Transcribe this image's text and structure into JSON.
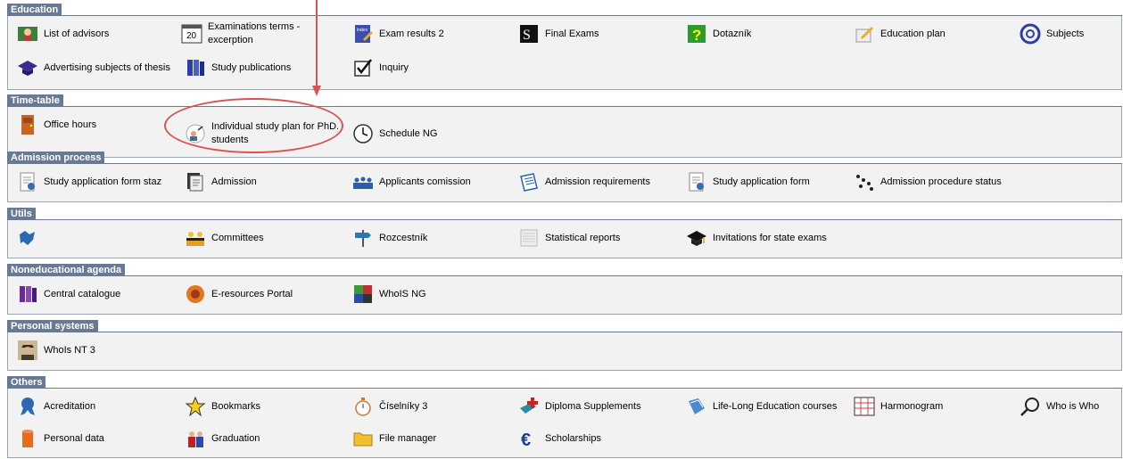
{
  "sections": [
    {
      "title": "Education",
      "items": [
        {
          "label": "List of advisors",
          "icon": "advisors-icon"
        },
        {
          "label": "Examinations terms - excerption",
          "icon": "calendar-icon"
        },
        {
          "label": "Exam results 2",
          "icon": "index-book-icon"
        },
        {
          "label": "Final Exams",
          "icon": "final-exams-icon"
        },
        {
          "label": "Dotazník",
          "icon": "questionnaire-icon"
        },
        {
          "label": "Education plan",
          "icon": "pencil-paper-icon"
        },
        {
          "label": "Subjects",
          "icon": "knot-icon"
        },
        {
          "label": "Advertising subjects of thesis",
          "icon": "graduation-cap-icon"
        },
        {
          "label": "Study publications",
          "icon": "books-icon"
        },
        {
          "label": "Inquiry",
          "icon": "checkbox-icon"
        }
      ]
    },
    {
      "title": "Time-table",
      "items": [
        {
          "label": "Office hours",
          "icon": "door-icon"
        },
        {
          "label": "Individual study plan for PhD. students",
          "icon": "study-plan-icon"
        },
        {
          "label": "Schedule NG",
          "icon": "clock-icon"
        }
      ]
    },
    {
      "title": "Admission process",
      "items": [
        {
          "label": "Study application form staz",
          "icon": "application-form-icon"
        },
        {
          "label": "Admission",
          "icon": "admission-doc-icon"
        },
        {
          "label": "Applicants comission",
          "icon": "people-icon"
        },
        {
          "label": "Admission requirements",
          "icon": "notepad-icon"
        },
        {
          "label": "Study application form",
          "icon": "application-form-icon"
        },
        {
          "label": "Admission procedure status",
          "icon": "dots-status-icon"
        }
      ]
    },
    {
      "title": "Utils",
      "items": [
        {
          "label": "",
          "icon": "map-icon"
        },
        {
          "label": "Committees",
          "icon": "committee-icon"
        },
        {
          "label": "Rozcestník",
          "icon": "signpost-icon"
        },
        {
          "label": "Statistical reports",
          "icon": "report-icon"
        },
        {
          "label": "Invitations for state exams",
          "icon": "mortarboard-icon"
        }
      ]
    },
    {
      "title": "Noneducational agenda",
      "items": [
        {
          "label": "Central catalogue",
          "icon": "catalogue-icon"
        },
        {
          "label": "E-resources Portal",
          "icon": "e-resources-icon"
        },
        {
          "label": "WhoIS NG",
          "icon": "puzzle-icon"
        }
      ]
    },
    {
      "title": "Personal systems",
      "items": [
        {
          "label": "WhoIs NT 3",
          "icon": "person-photo-icon"
        }
      ]
    },
    {
      "title": "Others",
      "items": [
        {
          "label": "Acreditation",
          "icon": "ribbon-icon"
        },
        {
          "label": "Bookmarks",
          "icon": "star-icon"
        },
        {
          "label": "Číselníky 3",
          "icon": "stopwatch-icon"
        },
        {
          "label": "Diploma Supplements",
          "icon": "medical-cross-icon"
        },
        {
          "label": "Life-Long Education courses",
          "icon": "book-blue-icon"
        },
        {
          "label": "Harmonogram",
          "icon": "calendar-grid-icon"
        },
        {
          "label": "Who is Who",
          "icon": "magnifier-icon"
        },
        {
          "label": "Personal data",
          "icon": "cylinder-icon"
        },
        {
          "label": "Graduation",
          "icon": "graduation-icon"
        },
        {
          "label": "File manager",
          "icon": "folder-icon"
        },
        {
          "label": "Scholarships",
          "icon": "euro-icon"
        }
      ]
    }
  ],
  "colors": {
    "header_bg": "#687995",
    "body_bg": "#f2f2f2",
    "annotation": "#d9534f"
  }
}
